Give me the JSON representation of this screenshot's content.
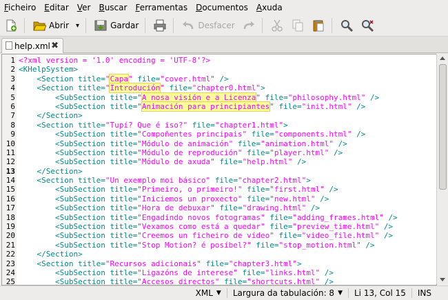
{
  "menubar": {
    "items": [
      {
        "mnemonic": "F",
        "rest": "icheiro"
      },
      {
        "mnemonic": "E",
        "rest": "ditar"
      },
      {
        "mnemonic": "V",
        "rest": "er"
      },
      {
        "mnemonic": "B",
        "rest": "uscar"
      },
      {
        "mnemonic": "F",
        "rest": "erramentas"
      },
      {
        "mnemonic": "D",
        "rest": "ocumentos"
      },
      {
        "mnemonic": "A",
        "rest": "xuda"
      }
    ]
  },
  "toolbar": {
    "new_icon": "new-document-icon",
    "open_label": "Abrir",
    "save_label": "Gardar",
    "print_icon": "printer-icon",
    "undo_label": "Desfacer",
    "redo_icon": "redo-icon",
    "cut_icon": "scissors-icon",
    "copy_icon": "copy-icon",
    "paste_icon": "clipboard-icon",
    "find_icon": "magnifier-icon",
    "replace_icon": "find-replace-icon"
  },
  "tab": {
    "label": "help.xml"
  },
  "editor": {
    "current_line": 13,
    "lines": [
      "<?xml version = '1.0' encoding = 'UTF-8'?>",
      "<KHelpSystem>",
      "    <Section title=\"Capa\" file=\"cover.html\" />",
      "    <Section title=\"Introdución\" file=\"chapter0.html\">",
      "        <SubSection title=\"A nosa visión e a Licenza\" file=\"philosophy.html\" />",
      "        <SubSection title=\"Animación para principiantes\" file=\"init.html\" />",
      "    </Section>",
      "    <Section title=\"Tupí? Que é iso?\" file=\"chapter1.html\">",
      "        <SubSection title=\"Compoñentes principais\" file=\"components.html\" />",
      "        <SubSection title=\"Módulo de animación\" file=\"animation.html\" />",
      "        <SubSection title=\"Módulo de reprodución\" file=\"player.html\" />",
      "        <SubSection title=\"Módulo de axuda\" file=\"help.html\" />",
      "    </Section>",
      "    <Section title=\"Un exemplo moi básico\" file=\"chapter2.html\">",
      "        <SubSection title=\"Primeiro, o primeiro!\" file=\"first.html\" />",
      "        <SubSection title=\"Iniciemos un proxecto\" file=\"new.html\" />",
      "        <SubSection title=\"Hora de debuxar\" file=\"drawing.html\" />",
      "        <SubSection title=\"Engadindo novos fotogramas\" file=\"adding_frames.html\" />",
      "        <SubSection title=\"Vexamos como está a quedar\" file=\"preview_time.html\" />",
      "        <SubSection title=\"Creemos un ficheiro de vídeo\" file=\"video_file.html\" />",
      "        <SubSection title=\"Stop Motion? é posíbel?\" file=\"stop_motion.html\" />",
      "    </Section>",
      "    <Section title=\"Recursos adicionais\" file=\"chapter3.html\">",
      "        <SubSection title=\"Ligazóns de interese\" file=\"links.html\" />",
      "        <SubSection title=\"Accesos directos\" file=\"shortcuts.html\" />"
    ],
    "highlighted_titles": [
      "Capa",
      "Introdución",
      "A nosa visión e a Licenza",
      "Animación para principiantes"
    ]
  },
  "statusbar": {
    "language": "XML",
    "tab_width": "Largura da tabulación: 8",
    "position": "Li 13, Col 15",
    "mode": "INS"
  },
  "colors": {
    "tag": "#008b8b",
    "string": "#ff00ff",
    "highlight": "#ffff99"
  }
}
